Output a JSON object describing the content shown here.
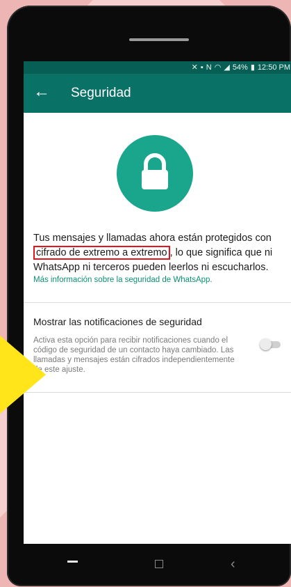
{
  "statusbar": {
    "battery": "54%",
    "time": "12:50 PM"
  },
  "appbar": {
    "title": "Seguridad",
    "back_icon": "arrow-left-icon"
  },
  "hero": {
    "icon": "lock-icon",
    "color": "#1aa68c"
  },
  "notice": {
    "before": "Tus mensajes y llamadas ahora están protegidos con",
    "highlight": "cifrado de extremo a extremo",
    "after": ", lo que significa que ni WhatsApp ni terceros pueden leerlos ni escucharlos."
  },
  "more_info_link": "Más información sobre la seguridad de WhatsApp.",
  "setting": {
    "title": "Mostrar las notificaciones de seguridad",
    "description": "Activa esta opción para recibir notificaciones cuando el código de seguridad de un contacto haya cambiado. Las llamadas y mensajes están cifrados independientemente de este ajuste.",
    "toggle_on": false
  },
  "colors": {
    "appbar": "#0a7166",
    "statusbar": "#075e54",
    "accent": "#0a8f73",
    "highlight_border": "#e3141b",
    "arrow": "#ffe51a"
  }
}
